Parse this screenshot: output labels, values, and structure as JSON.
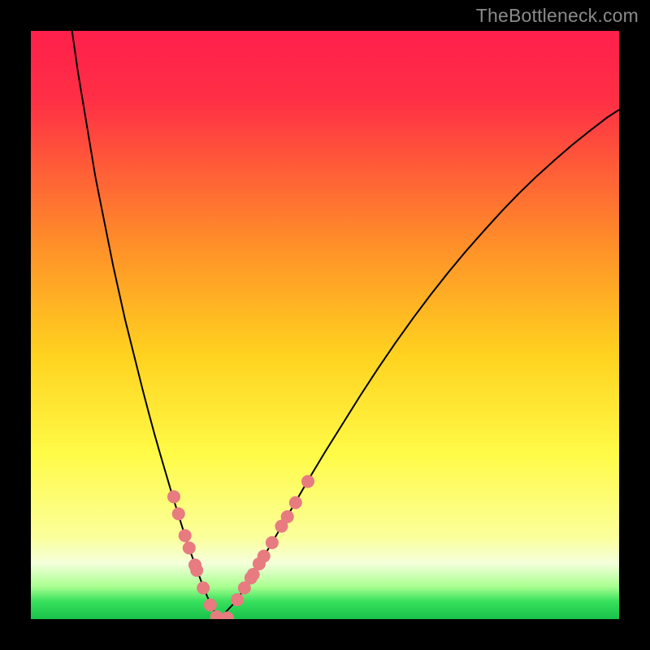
{
  "watermark": "TheBottleneck.com",
  "chart_data": {
    "type": "line",
    "title": "",
    "xlabel": "",
    "ylabel": "",
    "xlim": [
      0,
      100
    ],
    "ylim": [
      0,
      100
    ],
    "grid": false,
    "gradient_stops": [
      {
        "offset": 0,
        "color": "#ff1f4b"
      },
      {
        "offset": 0.12,
        "color": "#ff3045"
      },
      {
        "offset": 0.35,
        "color": "#ff8a2a"
      },
      {
        "offset": 0.55,
        "color": "#ffd21f"
      },
      {
        "offset": 0.72,
        "color": "#fffb47"
      },
      {
        "offset": 0.86,
        "color": "#fbff9a"
      },
      {
        "offset": 0.905,
        "color": "#f4ffdb"
      },
      {
        "offset": 0.945,
        "color": "#a7ff8f"
      },
      {
        "offset": 0.97,
        "color": "#37e05c"
      },
      {
        "offset": 1.0,
        "color": "#19c24a"
      }
    ],
    "series": [
      {
        "name": "curve-left",
        "x": [
          7,
          8,
          9,
          10,
          11,
          12,
          13,
          14,
          15,
          16,
          17,
          18,
          19,
          20,
          21,
          22,
          23,
          24,
          25,
          26,
          27,
          28,
          29,
          30,
          31,
          32
        ],
        "y": [
          100,
          93,
          87,
          81,
          75,
          70,
          65,
          60,
          55.5,
          51,
          47,
          43,
          39,
          35.2,
          31.5,
          28,
          24.6,
          21.2,
          18,
          14.8,
          11.8,
          9,
          6.3,
          3.8,
          1.6,
          0
        ]
      },
      {
        "name": "curve-right",
        "x": [
          32,
          35,
          38,
          41,
          44,
          47,
          50,
          53,
          56,
          59,
          62,
          65,
          68,
          71,
          74,
          77,
          80,
          83,
          86,
          89,
          92,
          95,
          98,
          100
        ],
        "y": [
          0,
          3.2,
          8,
          13,
          18.2,
          23.4,
          28.4,
          33.2,
          38,
          42.6,
          47,
          51.2,
          55.2,
          59,
          62.6,
          66,
          69.3,
          72.4,
          75.3,
          78,
          80.6,
          83,
          85.3,
          86.6
        ]
      }
    ],
    "points_left": [
      {
        "x": 24.3,
        "y": 20.8
      },
      {
        "x": 25.1,
        "y": 17.9
      },
      {
        "x": 26.2,
        "y": 14.2
      },
      {
        "x": 26.9,
        "y": 12.1
      },
      {
        "x": 27.9,
        "y": 9.2
      },
      {
        "x": 28.2,
        "y": 8.3
      },
      {
        "x": 29.3,
        "y": 5.3
      },
      {
        "x": 30.5,
        "y": 2.4
      },
      {
        "x": 31.6,
        "y": 0.4
      },
      {
        "x": 33.4,
        "y": 0.2
      }
    ],
    "points_right": [
      {
        "x": 35.1,
        "y": 3.3
      },
      {
        "x": 36.3,
        "y": 5.3
      },
      {
        "x": 37.4,
        "y": 7.0
      },
      {
        "x": 37.8,
        "y": 7.6
      },
      {
        "x": 38.8,
        "y": 9.4
      },
      {
        "x": 39.6,
        "y": 10.7
      },
      {
        "x": 41.0,
        "y": 13.0
      },
      {
        "x": 42.6,
        "y": 15.8
      },
      {
        "x": 43.6,
        "y": 17.4
      },
      {
        "x": 45.0,
        "y": 19.8
      },
      {
        "x": 47.1,
        "y": 23.4
      }
    ],
    "point_color": "#e77b80",
    "point_radius_px": 8
  }
}
